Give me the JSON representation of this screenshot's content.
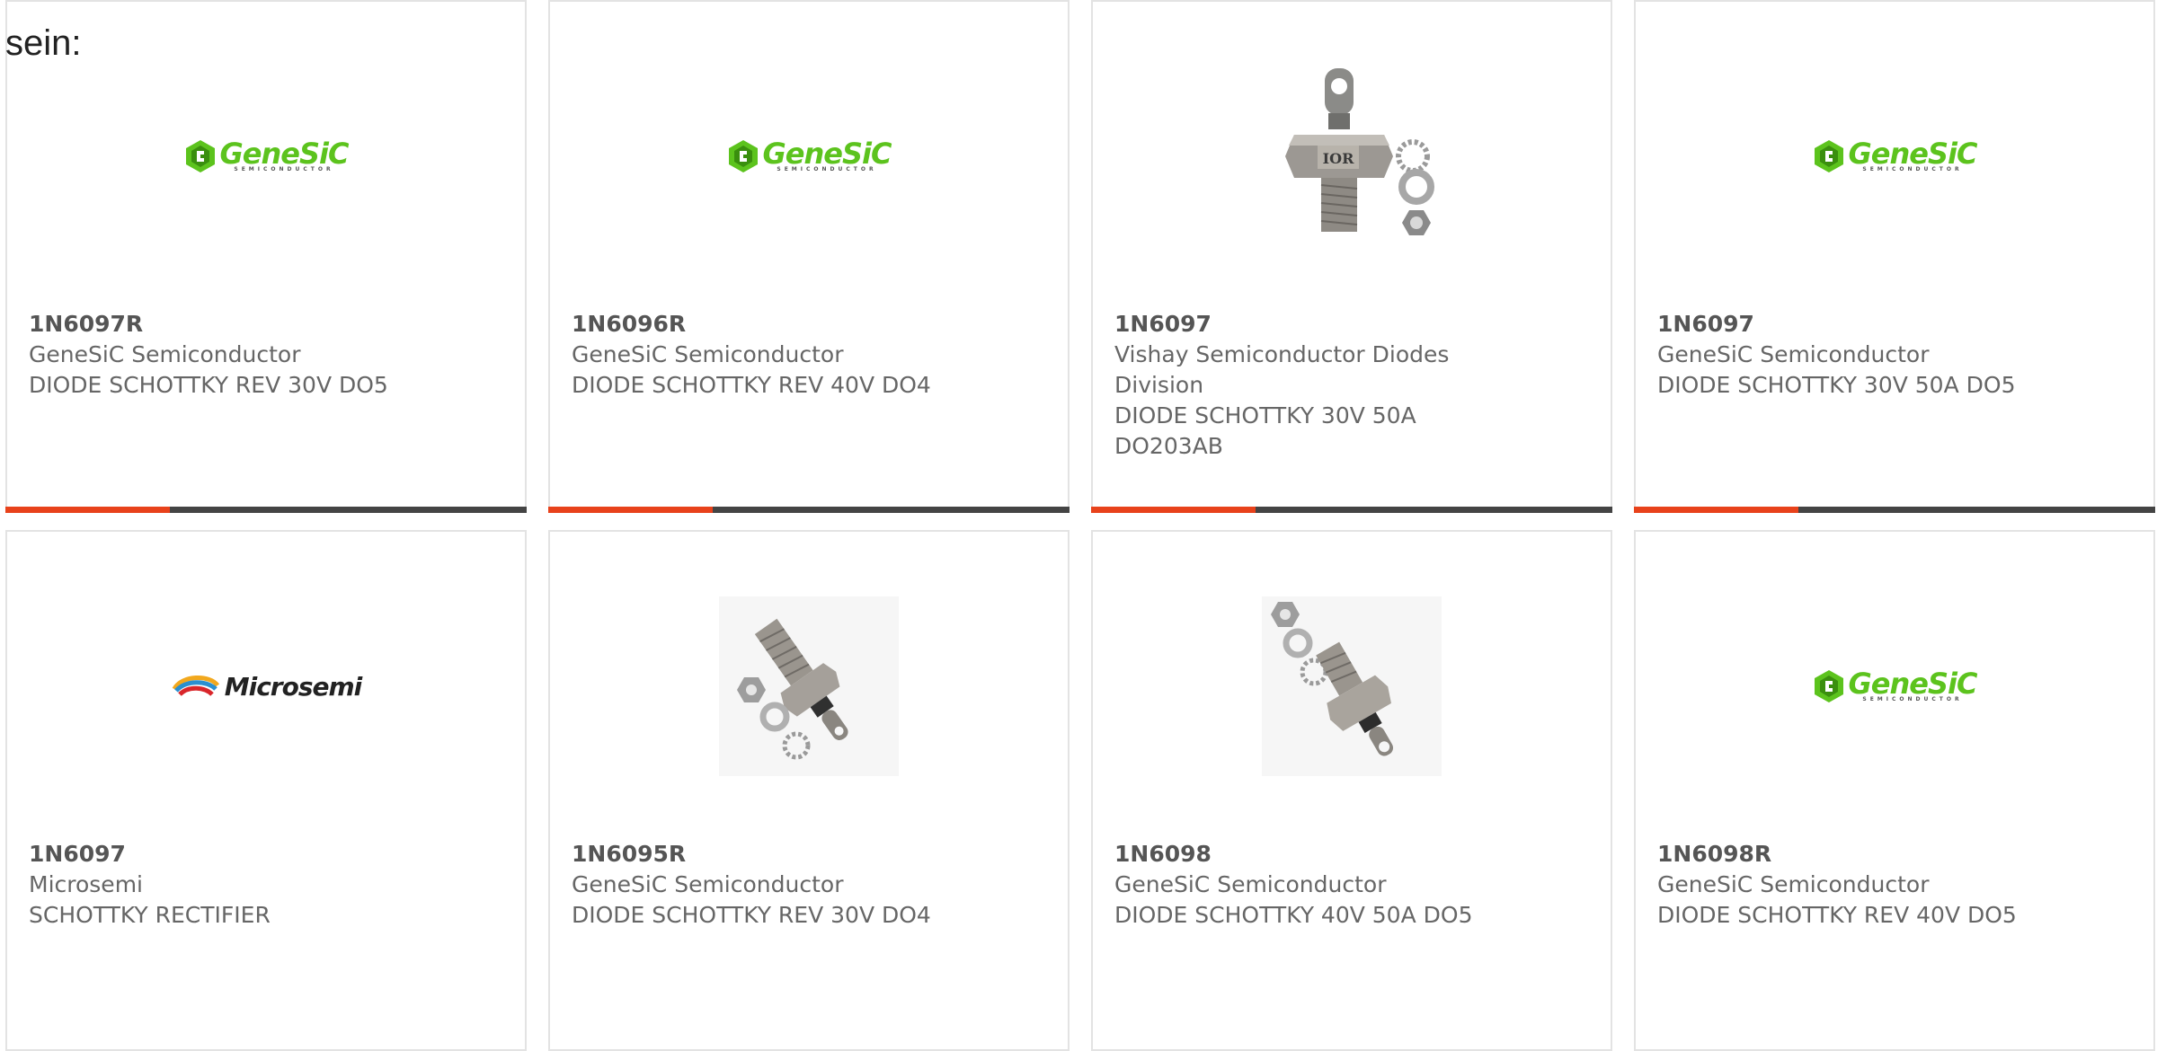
{
  "intro_text": "sein:",
  "accent_color": "#e8421b",
  "bar_color": "#444444",
  "products": [
    {
      "part": "1N6097R",
      "manufacturer": "GeneSiC Semiconductor",
      "description": "DIODE SCHOTTKY REV 30V DO5",
      "image": "genesic-logo"
    },
    {
      "part": "1N6096R",
      "manufacturer": "GeneSiC Semiconductor",
      "description": "DIODE SCHOTTKY REV 40V DO4",
      "image": "genesic-logo"
    },
    {
      "part": "1N6097",
      "manufacturer": "Vishay Semiconductor Diodes Division",
      "description": "DIODE SCHOTTKY 30V 50A DO203AB",
      "image": "stud-diode-photo"
    },
    {
      "part": "1N6097",
      "manufacturer": "GeneSiC Semiconductor",
      "description": "DIODE SCHOTTKY 30V 50A DO5",
      "image": "genesic-logo"
    },
    {
      "part": "1N6097",
      "manufacturer": "Microsemi",
      "description": "SCHOTTKY RECTIFIER",
      "image": "microsemi-logo"
    },
    {
      "part": "1N6095R",
      "manufacturer": "GeneSiC Semiconductor",
      "description": "DIODE SCHOTTKY REV 30V DO4",
      "image": "stud-diode-photo"
    },
    {
      "part": "1N6098",
      "manufacturer": "GeneSiC Semiconductor",
      "description": "DIODE SCHOTTKY 40V 50A DO5",
      "image": "stud-diode-photo"
    },
    {
      "part": "1N6098R",
      "manufacturer": "GeneSiC Semiconductor",
      "description": "DIODE SCHOTTKY REV 40V DO5",
      "image": "genesic-logo"
    }
  ],
  "logos": {
    "genesic_word": "GeneSiC",
    "genesic_sub": "SEMICONDUCTOR",
    "microsemi_word": "Microsemi",
    "ior_mark": "IOR"
  }
}
